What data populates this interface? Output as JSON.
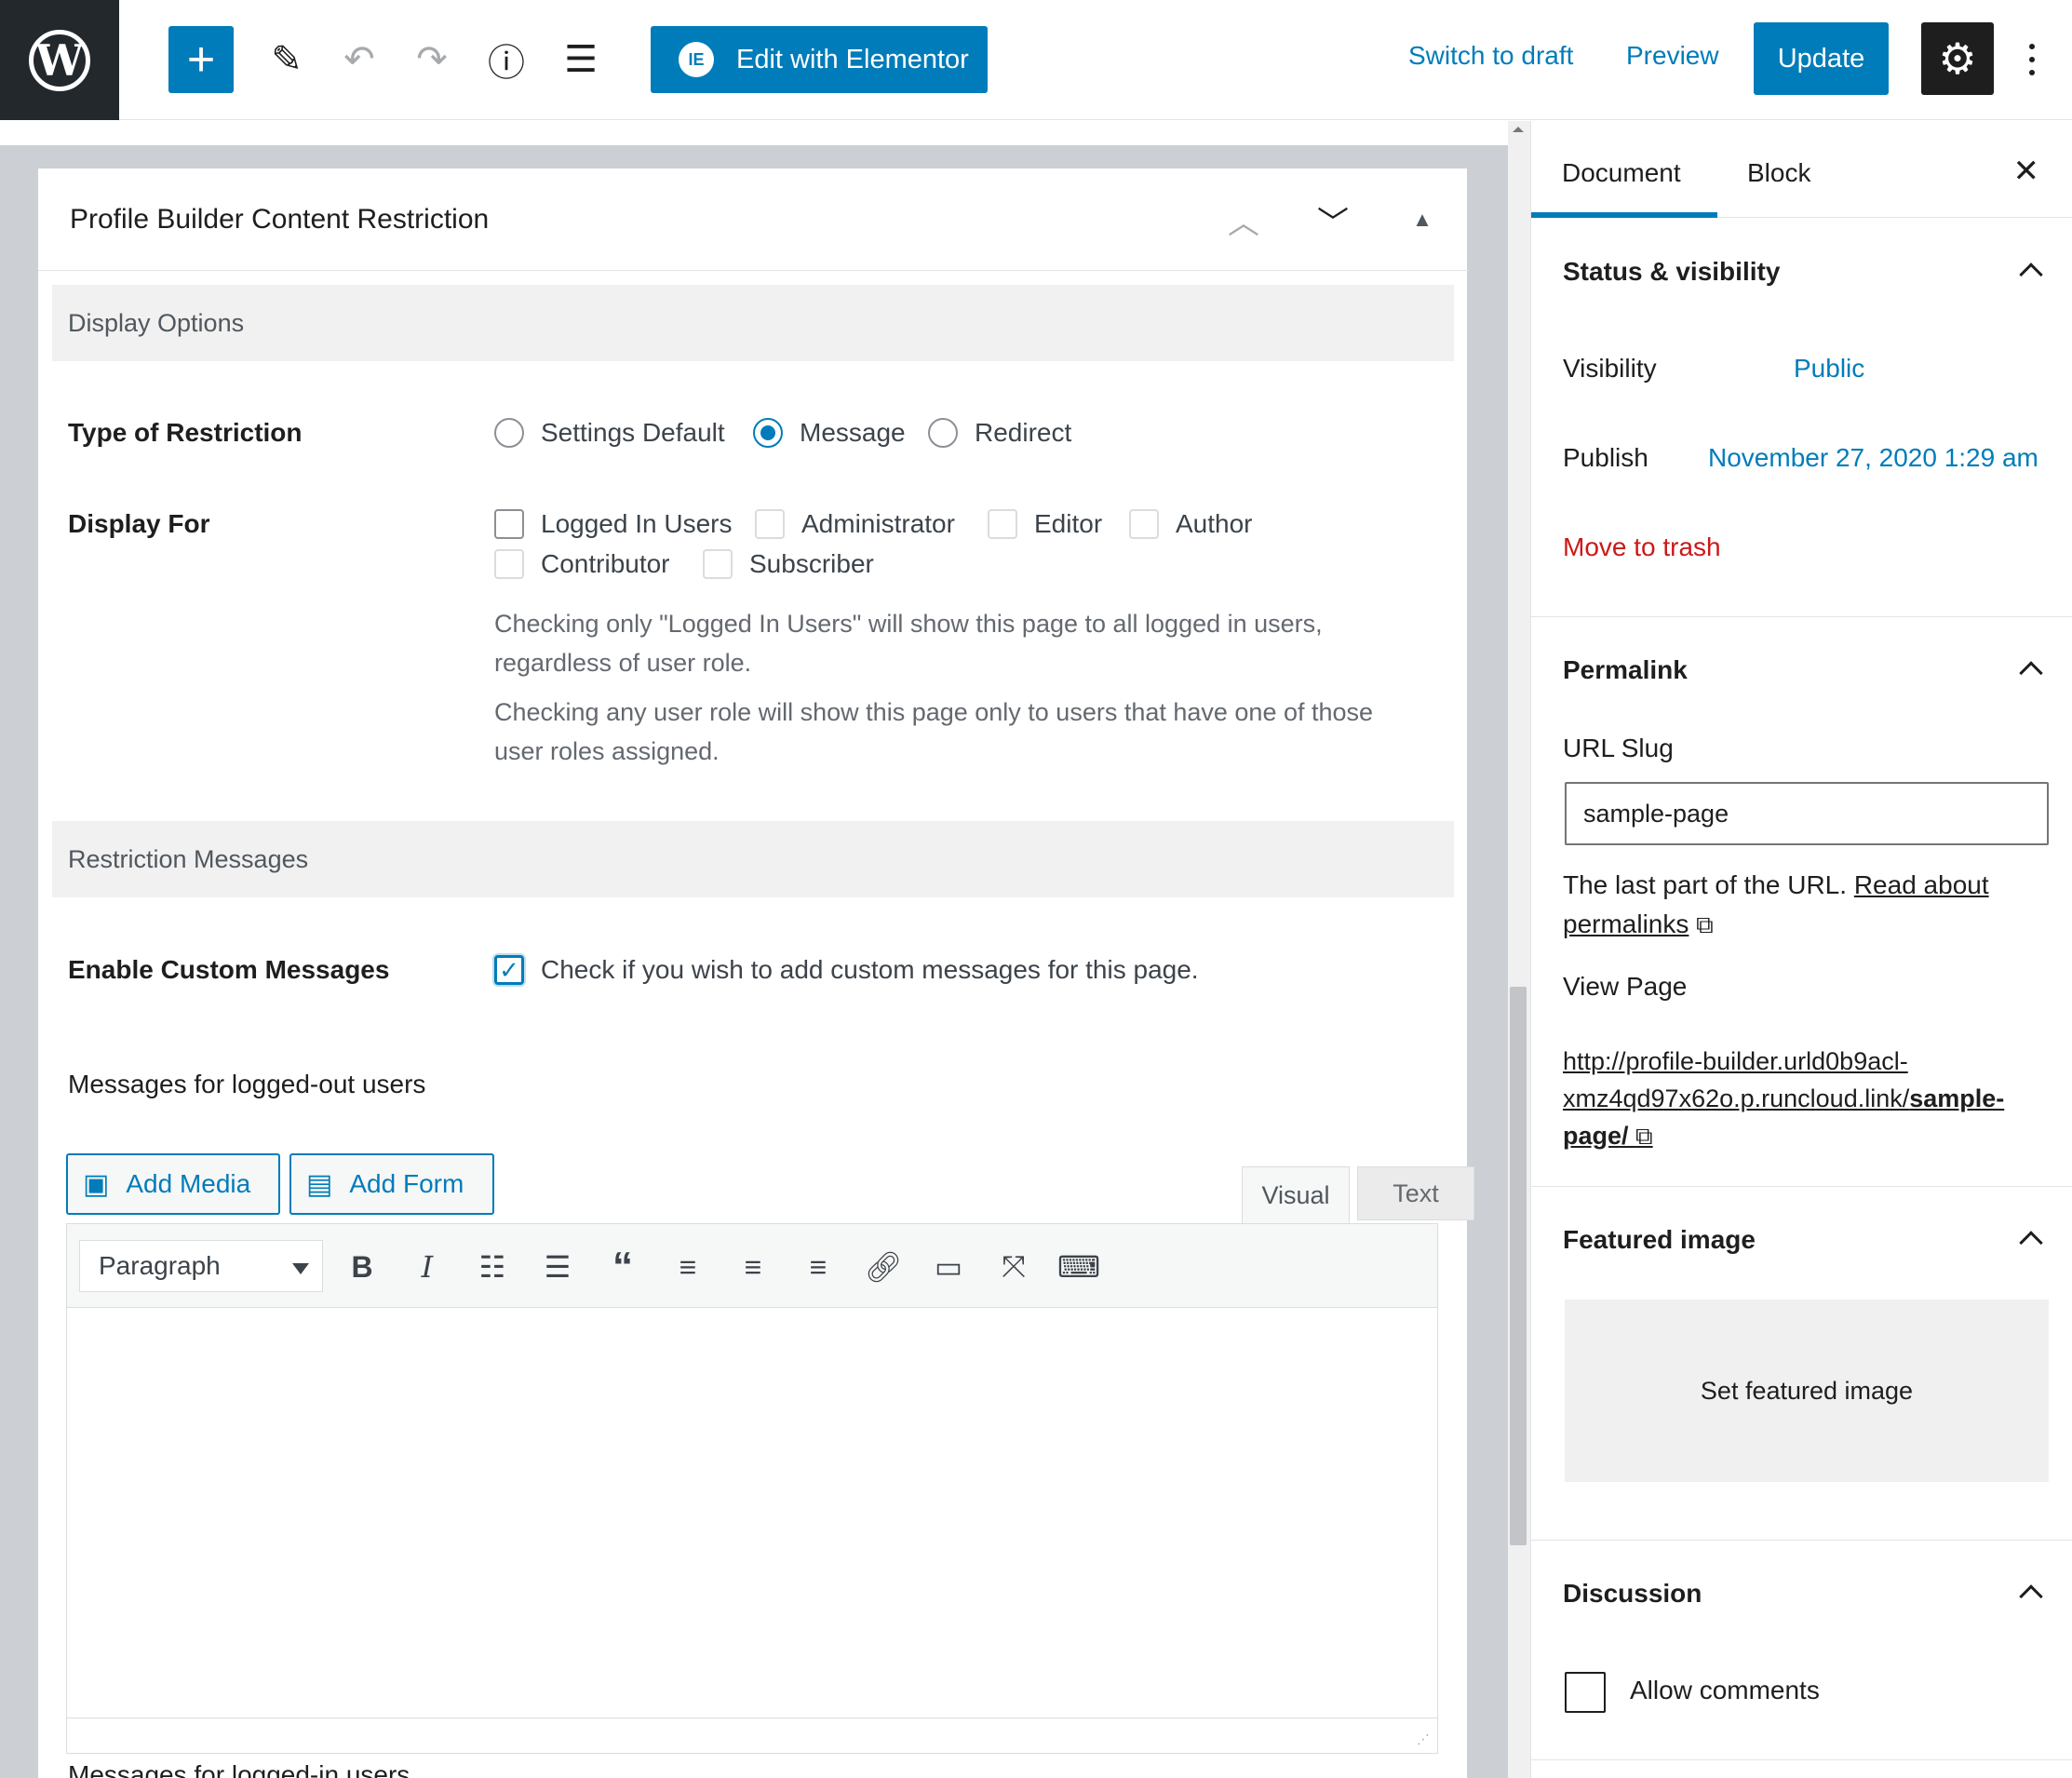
{
  "topbar": {
    "elementor_label": "Edit with Elementor",
    "elementor_icon_text": "IE",
    "switch_draft": "Switch to draft",
    "preview": "Preview",
    "update": "Update"
  },
  "metabox": {
    "title": "Profile Builder Content Restriction",
    "display_options": "Display Options",
    "type_of_restriction": {
      "label": "Type of Restriction",
      "options": [
        "Settings Default",
        "Message",
        "Redirect"
      ],
      "selected": "Message"
    },
    "display_for": {
      "label": "Display For",
      "options": [
        "Logged In Users",
        "Administrator",
        "Editor",
        "Author",
        "Contributor",
        "Subscriber"
      ],
      "desc1_line1": "Checking only \"Logged In Users\" will show this page to all logged in users,",
      "desc1_line2": "regardless of user role.",
      "desc2_line1": "Checking any user role will show this page only to users that have one of those",
      "desc2_line2": "user roles assigned."
    },
    "restriction_messages": "Restriction Messages",
    "enable_custom": {
      "label": "Enable Custom Messages",
      "text": "Check if you wish to add custom messages for this page.",
      "checked": true
    },
    "logged_out_label": "Messages for logged-out users",
    "logged_in_label": "Messages for logged-in users",
    "add_media": "Add Media",
    "add_form": "Add Form",
    "tab_visual": "Visual",
    "tab_text": "Text",
    "format_select": "Paragraph"
  },
  "sidebar": {
    "tab_document": "Document",
    "tab_block": "Block",
    "status": {
      "title": "Status & visibility",
      "visibility_label": "Visibility",
      "visibility_value": "Public",
      "publish_label": "Publish",
      "publish_value": "November 27, 2020 1:29 am",
      "trash": "Move to trash"
    },
    "permalink": {
      "title": "Permalink",
      "slug_label": "URL Slug",
      "slug_value": "sample-page",
      "help_text": "The last part of the URL.",
      "help_link_1": "Read about",
      "help_link_2": "permalinks",
      "view_page": "View Page",
      "url_line1": "http://profile-builder.urld0b9acl-",
      "url_line2a": "xmz4qd97x62o.p.runcloud.link/",
      "url_line2b": "sample-",
      "url_line3": "page/"
    },
    "featured": {
      "title": "Featured image",
      "button": "Set featured image"
    },
    "discussion": {
      "title": "Discussion",
      "allow_comments": "Allow comments"
    }
  },
  "colors": {
    "accent": "#007cba",
    "danger": "#cc1818",
    "dark": "#1e1e1e"
  }
}
